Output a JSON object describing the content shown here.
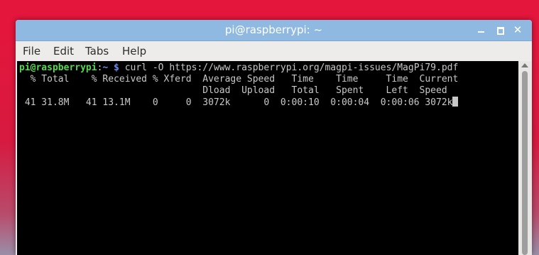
{
  "window": {
    "title": "pi@raspberrypi: ~"
  },
  "menu": {
    "file": "File",
    "edit": "Edit",
    "tabs": "Tabs",
    "help": "Help"
  },
  "terminal": {
    "prompt_user": "pi@raspberrypi",
    "prompt_sep": ":",
    "prompt_path": "~ $",
    "command": " curl -O https://www.raspberrypi.org/magpi-issues/MagPi79.pdf",
    "header1": "  % Total    % Received % Xferd  Average Speed   Time    Time     Time  Current",
    "header2": "                                 Dload  Upload   Total   Spent    Left  Speed",
    "progress": " 41 31.8M   41 13.1M    0     0  3072k      0  0:00:10  0:00:04  0:00:06 3072k"
  },
  "colors": {
    "titlebar": "#8fb9e0",
    "prompt_user": "#55d94d",
    "prompt_path": "#6e8cf0",
    "desktop": "#e4163c"
  }
}
